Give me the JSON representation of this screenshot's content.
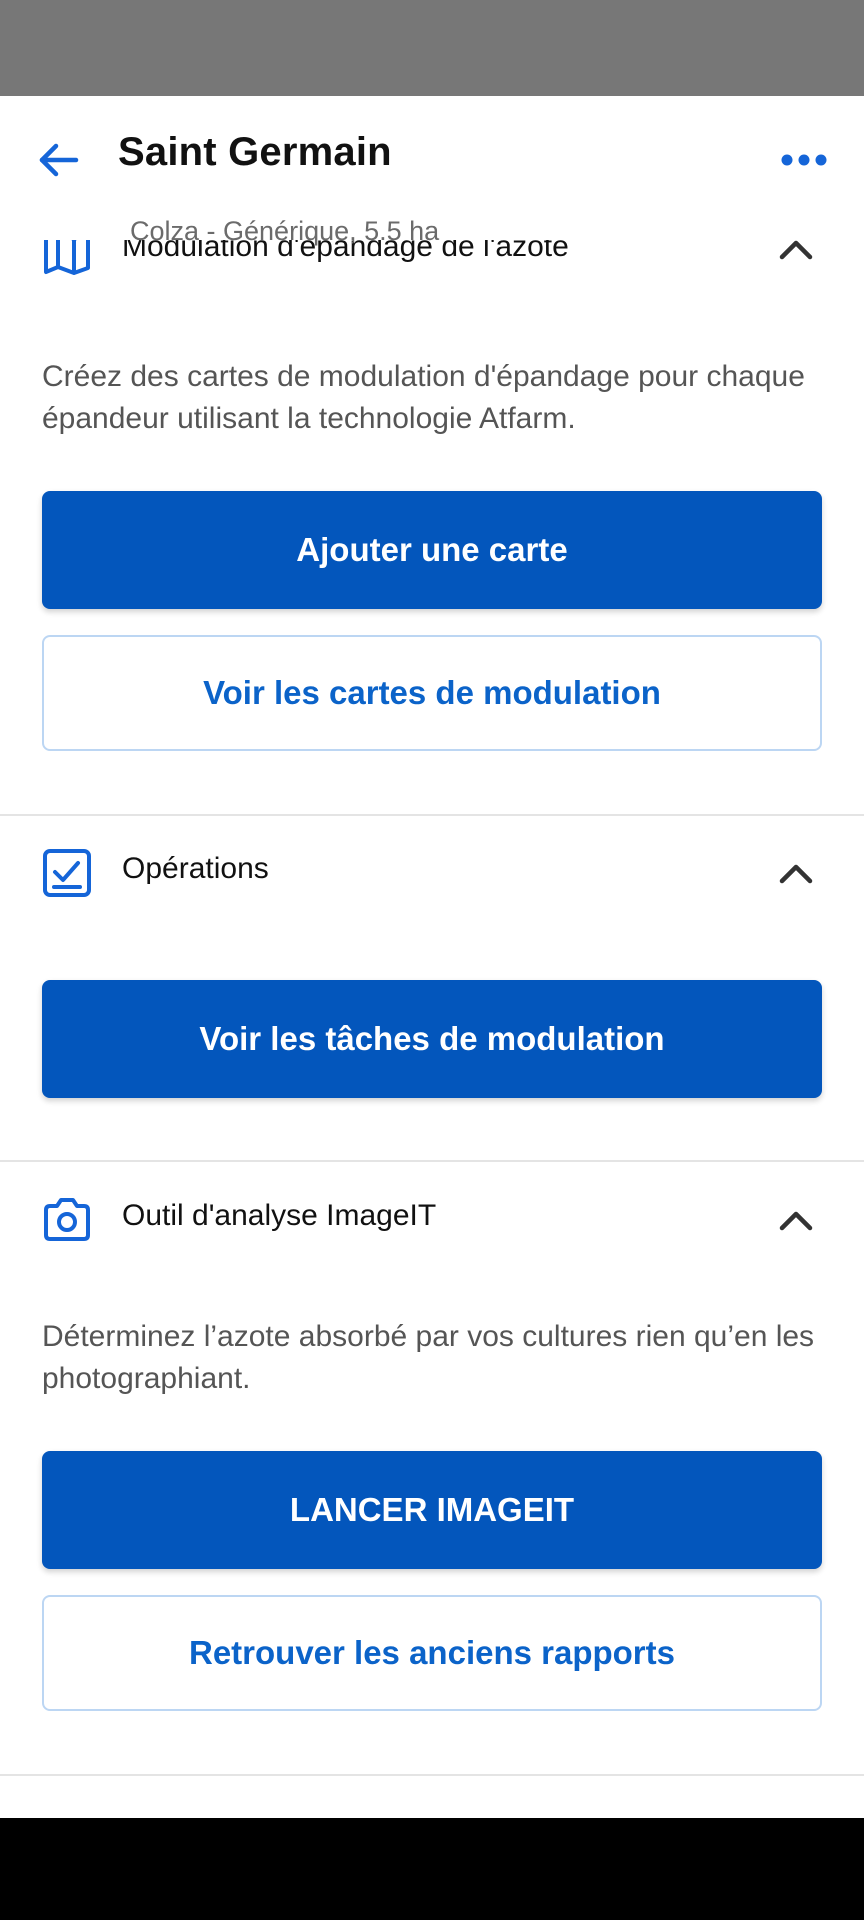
{
  "header": {
    "title": "Saint Germain",
    "subtitle": "Colza - Générique, 5.5 ha",
    "back_icon": "arrow-left-icon",
    "more_icon": "more-horizontal-icon"
  },
  "sections": {
    "nitrogen": {
      "title": "Modulation d'épandage de l'azote",
      "icon": "map-icon",
      "description": "Créez des cartes de modulation d'épandage pour chaque épandeur utilisant la technologie Atfarm.",
      "primary_label": "Ajouter une carte",
      "secondary_label": "Voir les cartes de modulation"
    },
    "operations": {
      "title": "Opérations",
      "icon": "checkbox-icon",
      "primary_label": "Voir les tâches de modulation"
    },
    "imageit": {
      "title": "Outil d'analyse ImageIT",
      "icon": "camera-icon",
      "description": "Déterminez l’azote absorbé par vos cultures rien qu’en les photographiant.",
      "primary_label": "LANCER IMAGEIT",
      "secondary_label": "Retrouver les anciens rapports"
    }
  },
  "colors": {
    "primary": "#0356bc",
    "link": "#0b63c9",
    "icon": "#1565d8"
  }
}
